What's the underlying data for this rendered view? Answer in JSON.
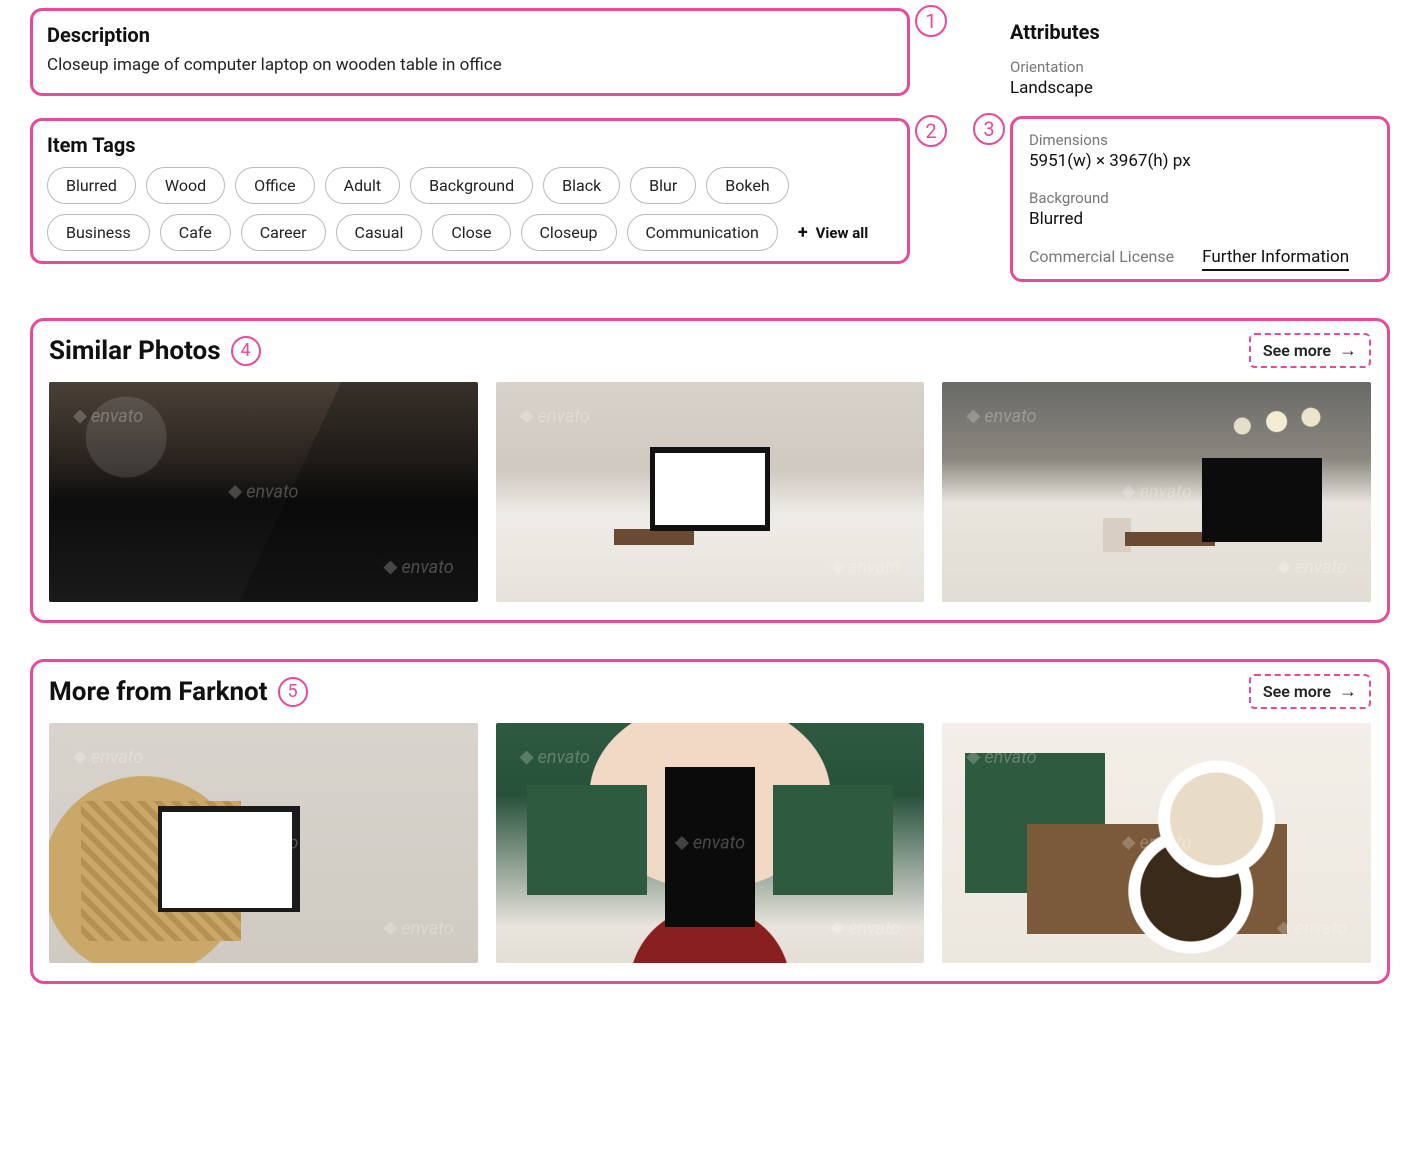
{
  "description": {
    "heading": "Description",
    "text": "Closeup image of computer laptop on wooden table in office"
  },
  "item_tags": {
    "heading": "Item Tags",
    "tags": [
      "Blurred",
      "Wood",
      "Office",
      "Adult",
      "Background",
      "Black",
      "Blur",
      "Bokeh",
      "Business",
      "Cafe",
      "Career",
      "Casual",
      "Close",
      "Closeup",
      "Communication"
    ],
    "view_all_label": "View all"
  },
  "attributes": {
    "heading": "Attributes",
    "orientation_label": "Orientation",
    "orientation_value": "Landscape",
    "dimensions_label": "Dimensions",
    "dimensions_value": "5951(w) × 3967(h) px",
    "background_label": "Background",
    "background_value": "Blurred",
    "license_label": "Commercial License",
    "further_info_label": "Further Information"
  },
  "similar": {
    "heading": "Similar Photos",
    "see_more_label": "See more",
    "watermark_text": "envato"
  },
  "more_from": {
    "heading": "More from Farknot",
    "see_more_label": "See more",
    "watermark_text": "envato"
  },
  "annotations": {
    "one": "1",
    "two": "2",
    "three": "3",
    "four": "4",
    "five": "5"
  }
}
